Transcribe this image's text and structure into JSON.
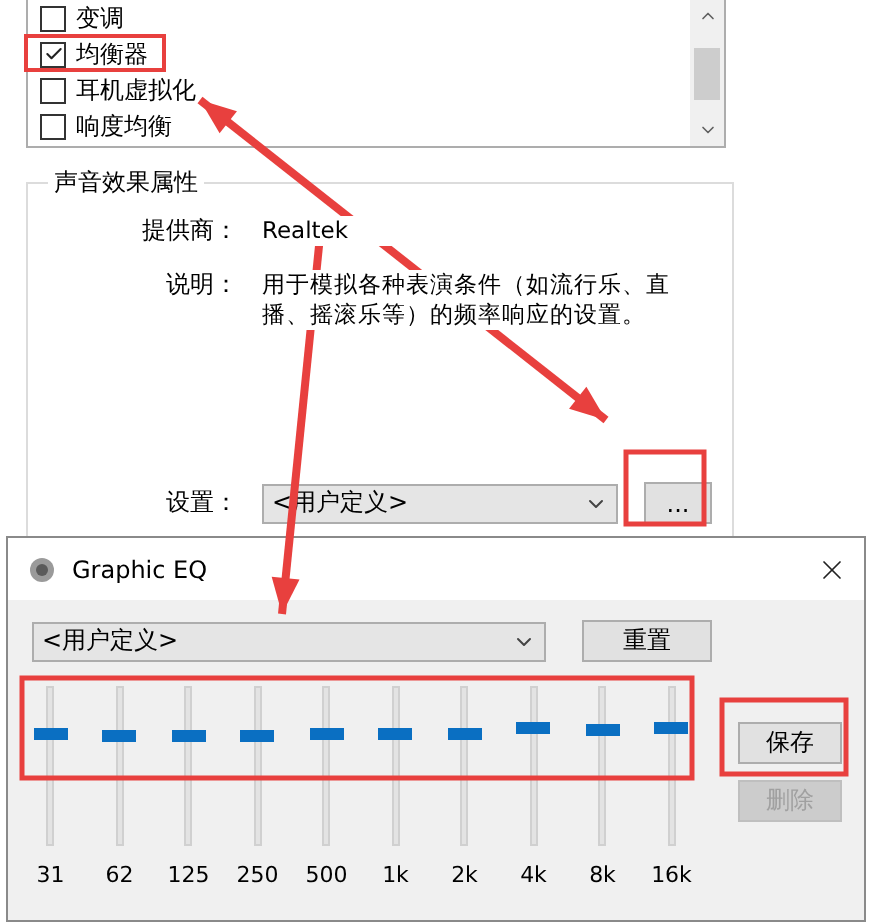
{
  "effects_list": {
    "items": [
      {
        "label": "变调",
        "checked": false
      },
      {
        "label": "均衡器",
        "checked": true
      },
      {
        "label": "耳机虚拟化",
        "checked": false
      },
      {
        "label": "响度均衡",
        "checked": false
      }
    ]
  },
  "properties": {
    "title": "声音效果属性",
    "provider_label": "提供商：",
    "provider": "Realtek",
    "description_label": "说明：",
    "description": "用于模拟各种表演条件（如流行乐、直播、摇滚乐等）的频率响应的设置。",
    "setting_label": "设置：",
    "setting_value": "<用户定义>",
    "more_button": "..."
  },
  "eq_window": {
    "title": "Graphic EQ",
    "preset": "<用户定义>",
    "reset_button": "重置",
    "save_button": "保存",
    "delete_button": {
      "label": "删除",
      "disabled": true
    },
    "bands": [
      {
        "label": "31",
        "level": 0.71
      },
      {
        "label": "62",
        "level": 0.69
      },
      {
        "label": "125",
        "level": 0.69
      },
      {
        "label": "250",
        "level": 0.69
      },
      {
        "label": "500",
        "level": 0.7
      },
      {
        "label": "1k",
        "level": 0.7
      },
      {
        "label": "2k",
        "level": 0.71
      },
      {
        "label": "4k",
        "level": 0.74
      },
      {
        "label": "8k",
        "level": 0.73
      },
      {
        "label": "16k",
        "level": 0.75
      }
    ]
  }
}
